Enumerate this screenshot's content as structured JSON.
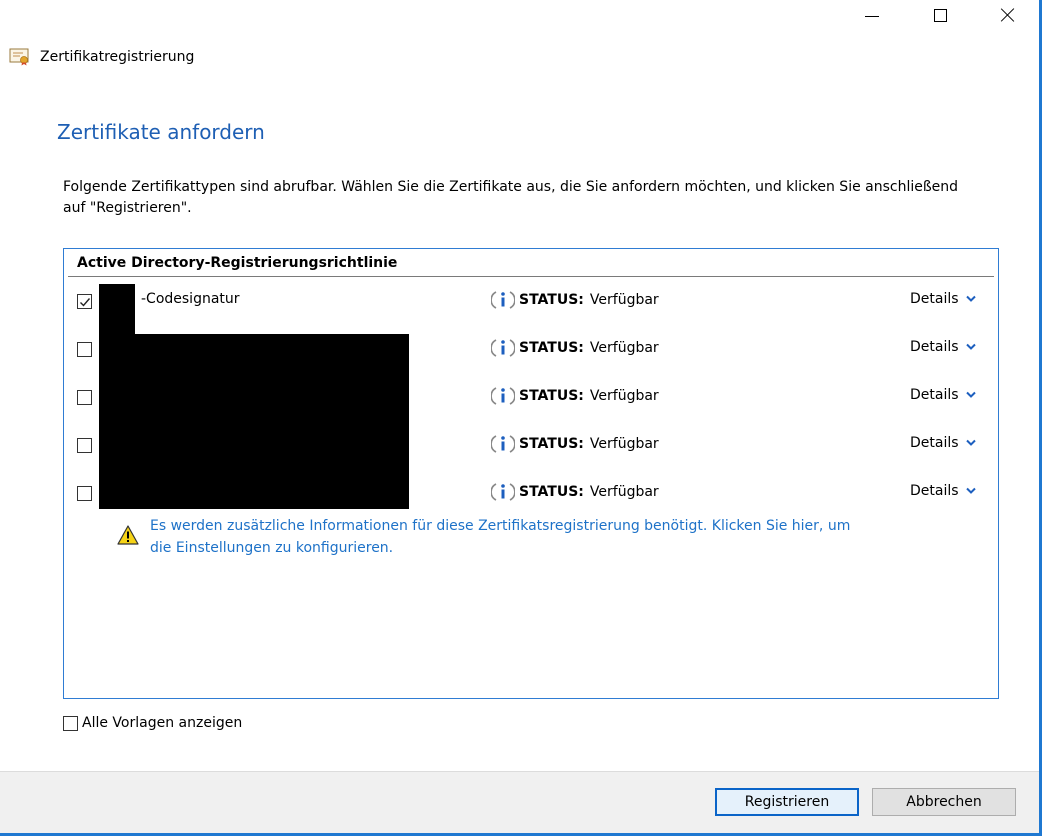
{
  "window": {
    "title": "Zertifikatregistrierung",
    "controls": [
      "minimize-icon",
      "maximize-icon",
      "close-icon"
    ]
  },
  "page": {
    "title": "Zertifikate anfordern",
    "description": "Folgende Zertifikattypen sind abrufbar. Wählen Sie die Zertifikate aus, die Sie anfordern möchten, und klicken Sie anschließend auf \"Registrieren\"."
  },
  "policy": {
    "header": "Active Directory-Registrierungsrichtlinie",
    "certificates": [
      {
        "name": "-Codesignatur",
        "checked": true,
        "status_label": "STATUS:",
        "status": "Verfügbar",
        "details": "Details"
      },
      {
        "name": "",
        "checked": false,
        "status_label": "STATUS:",
        "status": "Verfügbar",
        "details": "Details"
      },
      {
        "name": "",
        "checked": false,
        "status_label": "STATUS:",
        "status": "Verfügbar",
        "details": "Details"
      },
      {
        "name": "",
        "checked": false,
        "status_label": "STATUS:",
        "status": "Verfügbar",
        "details": "Details"
      },
      {
        "name": "",
        "checked": false,
        "status_label": "STATUS:",
        "status": "Verfügbar",
        "details": "Details"
      }
    ],
    "warning": "Es werden zusätzliche Informationen für diese Zertifikatsregistrierung benötigt. Klicken Sie hier, um die Einstellungen zu konfigurieren."
  },
  "show_all_templates": {
    "label": "Alle Vorlagen anzeigen",
    "checked": false
  },
  "buttons": {
    "register": "Registrieren",
    "cancel": "Abbrechen"
  },
  "colors": {
    "accent": "#1f78d1",
    "title": "#1e5fb4",
    "link": "#1e72c8"
  }
}
